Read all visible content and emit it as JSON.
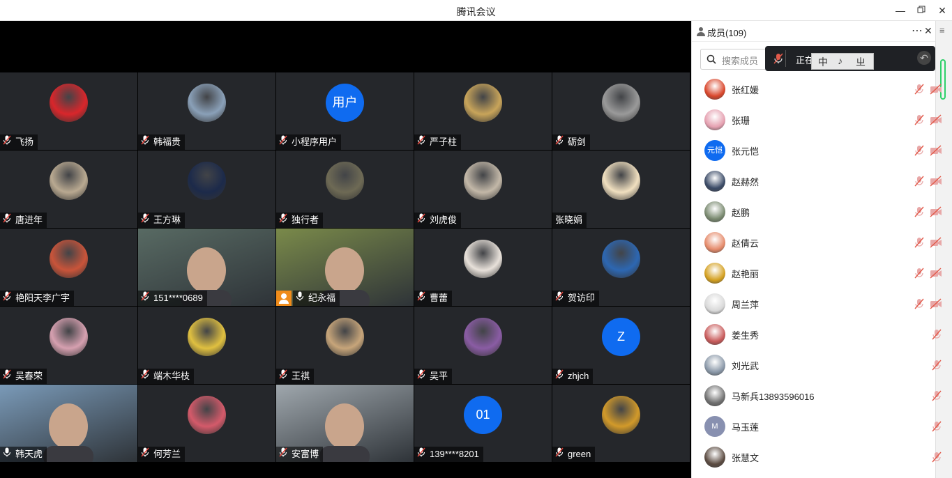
{
  "window": {
    "title": "腾讯会议"
  },
  "grid": {
    "tiles": [
      {
        "name": "飞扬",
        "avatar": "photo",
        "color": "#d9262b"
      },
      {
        "name": "韩福贵",
        "avatar": "photo",
        "color": "#8aa0b8"
      },
      {
        "name": "小程序用户",
        "avatar": "text",
        "text": "用户"
      },
      {
        "name": "严子柱",
        "avatar": "photo",
        "color": "#c8a45a"
      },
      {
        "name": "砺剑",
        "avatar": "photo",
        "color": "#9a9a9a"
      },
      {
        "name": "唐进年",
        "avatar": "photo",
        "color": "#b9a991"
      },
      {
        "name": "王方琳",
        "avatar": "photo",
        "color": "#1c2a4a"
      },
      {
        "name": "独行者",
        "avatar": "photo",
        "color": "#6e6a55"
      },
      {
        "name": "刘虎俊",
        "avatar": "photo",
        "color": "#c3b8a8"
      },
      {
        "name": "张晓娟",
        "avatar": "photo",
        "color": "#f1e0c0",
        "nomic": true
      },
      {
        "name": "艳阳天李广宇",
        "avatar": "photo",
        "color": "#c9543a"
      },
      {
        "name": "151****0689",
        "avatar": "video",
        "color": "#586a63"
      },
      {
        "name": "纪永福",
        "avatar": "video",
        "color": "#7a8a4a",
        "active": true,
        "host": true
      },
      {
        "name": "曹蕾",
        "avatar": "photo",
        "color": "#e8e1da"
      },
      {
        "name": "贺访印",
        "avatar": "photo",
        "color": "#2d67b2"
      },
      {
        "name": "吴春荣",
        "avatar": "photo",
        "color": "#d6a0b0"
      },
      {
        "name": "端木华枝",
        "avatar": "photo",
        "color": "#e0c040"
      },
      {
        "name": "王祺",
        "avatar": "photo",
        "color": "#c7a57a"
      },
      {
        "name": "吴平",
        "avatar": "photo",
        "color": "#8a5ca4"
      },
      {
        "name": "zhjch",
        "avatar": "text",
        "text": "Z"
      },
      {
        "name": "韩天虎",
        "avatar": "video",
        "color": "#7a9ab8",
        "micon": true
      },
      {
        "name": "何芳兰",
        "avatar": "photo",
        "color": "#d45a6a"
      },
      {
        "name": "安富博",
        "avatar": "video",
        "color": "#9fa7ad"
      },
      {
        "name": "139****8201",
        "avatar": "text",
        "text": "01"
      },
      {
        "name": "green",
        "avatar": "photo",
        "color": "#d29a2a"
      }
    ]
  },
  "panel": {
    "title": "成员(109)",
    "search_placeholder": "搜索成员",
    "toast_text": "正在",
    "watermark_chars": [
      "中",
      "♪",
      "ㄓ"
    ],
    "members": [
      {
        "name": "张红媛",
        "color": "#d9462b",
        "video_icon": true
      },
      {
        "name": "张珊",
        "color": "#e5a0b0",
        "video_icon": true
      },
      {
        "name": "张元恺",
        "color": "#0f6bf0",
        "avatar_text": "元恺",
        "video_icon": true
      },
      {
        "name": "赵赫然",
        "color": "#3a4a66",
        "video_icon": true
      },
      {
        "name": "赵鹏",
        "color": "#7a8a70",
        "video_icon": true
      },
      {
        "name": "赵倩云",
        "color": "#e58a6a",
        "video_icon": true
      },
      {
        "name": "赵艳丽",
        "color": "#d4a020",
        "video_icon": true
      },
      {
        "name": "周兰萍",
        "color": "#d8d8d8",
        "video_icon": true
      },
      {
        "name": "姜生秀",
        "color": "#c85a5a",
        "video_icon": false
      },
      {
        "name": "刘光武",
        "color": "#8a98a8",
        "video_icon": false
      },
      {
        "name": "马新兵13893596016",
        "color": "#707070",
        "video_icon": false
      },
      {
        "name": "马玉莲",
        "color": "#8890b0",
        "avatar_text": "M",
        "video_icon": false
      },
      {
        "name": "张慧文",
        "color": "#5a4a40",
        "video_icon": false
      }
    ]
  }
}
